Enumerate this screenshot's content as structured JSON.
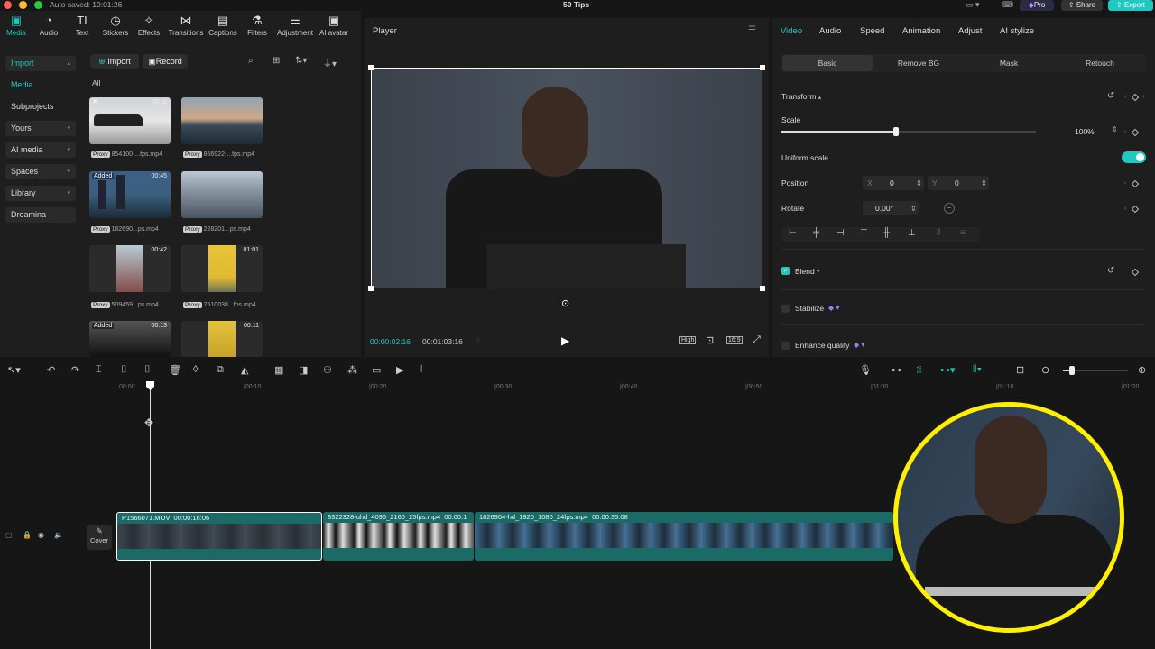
{
  "app": {
    "autosave": "Auto saved: 10:01:26",
    "project_title": "50 Tips",
    "pro_label": "Pro",
    "share_label": "Share",
    "export_label": "Export",
    "accent": "#1fc8c0"
  },
  "toolbar": {
    "items": [
      {
        "label": "Media",
        "icon": "media-icon",
        "active": true
      },
      {
        "label": "Audio",
        "icon": "audio-icon"
      },
      {
        "label": "Text",
        "icon": "text-icon"
      },
      {
        "label": "Stickers",
        "icon": "stickers-icon"
      },
      {
        "label": "Effects",
        "icon": "effects-icon"
      },
      {
        "label": "Transitions",
        "icon": "transitions-icon"
      },
      {
        "label": "Captions",
        "icon": "captions-icon"
      },
      {
        "label": "Filters",
        "icon": "filters-icon"
      },
      {
        "label": "Adjustment",
        "icon": "adjustment-icon"
      },
      {
        "label": "AI avatar",
        "icon": "ai-avatar-icon"
      }
    ]
  },
  "sidebar": {
    "items": [
      {
        "label": "Import",
        "active": true
      },
      {
        "label": "Media"
      },
      {
        "label": "Subprojects"
      },
      {
        "label": "Yours"
      },
      {
        "label": "AI media"
      },
      {
        "label": "Spaces"
      },
      {
        "label": "Library"
      },
      {
        "label": "Dreamina"
      }
    ]
  },
  "media": {
    "import_label": "Import",
    "record_label": "Record",
    "filter_label": "All",
    "items": [
      {
        "name": "854100-...fps.mp4",
        "proxy": "Proxy",
        "duration": "00:16"
      },
      {
        "name": "856922-...fps.mp4",
        "proxy": "Proxy",
        "duration": ""
      },
      {
        "name": "182690...ps.mp4",
        "proxy": "Proxy",
        "duration": "00:45",
        "badge": "Added"
      },
      {
        "name": "228201...ps.mp4",
        "proxy": "Proxy",
        "duration": ""
      },
      {
        "name": "509459...ps.mp4",
        "proxy": "Proxy",
        "duration": "00:42"
      },
      {
        "name": "7510038...fps.mp4",
        "proxy": "Proxy",
        "duration": "01:01"
      },
      {
        "name": "",
        "proxy": "",
        "duration": "00:13",
        "badge": "Added"
      },
      {
        "name": "",
        "proxy": "",
        "duration": "00:11"
      }
    ]
  },
  "player": {
    "title": "Player",
    "current_time": "00:00:02:16",
    "total_time": "00:01:03:16",
    "quality": "High",
    "ratio": "16:9"
  },
  "inspector": {
    "tabs": [
      "Video",
      "Audio",
      "Speed",
      "Animation",
      "Adjust",
      "AI stylize"
    ],
    "subtabs": [
      "Basic",
      "Remove BG",
      "Mask",
      "Retouch"
    ],
    "transform_label": "Transform",
    "scale_label": "Scale",
    "scale_value": "100%",
    "scale_fraction": 0.45,
    "uniform_label": "Uniform scale",
    "uniform_on": true,
    "position_label": "Position",
    "pos_x_label": "X",
    "pos_x": "0",
    "pos_y_label": "Y",
    "pos_y": "0",
    "rotate_label": "Rotate",
    "rotate_value": "0.00°",
    "blend_label": "Blend",
    "stabilize_label": "Stabilize",
    "enhance_label": "Enhance quality"
  },
  "timeline": {
    "ruler": [
      "00:00",
      "|00:10",
      "|00:20",
      "|00:30",
      "|00:40",
      "|00:50",
      "|01:00",
      "|01:10",
      "|01:20"
    ],
    "cover_label": "Cover",
    "clips": [
      {
        "name": "P1566071.MOV",
        "duration": "00:00:16:06"
      },
      {
        "name": "8322328-uhd_4096_2160_25fps.mp4",
        "duration": "00:00:1"
      },
      {
        "name": "1826904-hd_1920_1080_24fps.mp4",
        "duration": "00:00:35:08"
      }
    ]
  }
}
